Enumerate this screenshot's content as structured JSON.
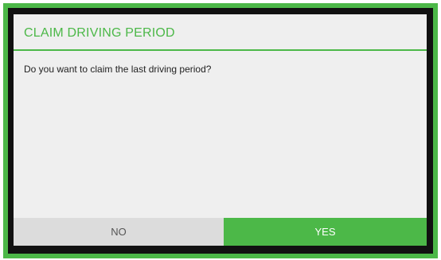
{
  "dialog": {
    "title": "CLAIM DRIVING PERIOD",
    "message": "Do you want to claim the last driving period?",
    "no_label": "NO",
    "yes_label": "YES"
  },
  "colors": {
    "accent": "#4cb848",
    "frame_inner": "#111111",
    "dialog_bg": "#efefef",
    "no_button_bg": "#dcdcdc"
  }
}
